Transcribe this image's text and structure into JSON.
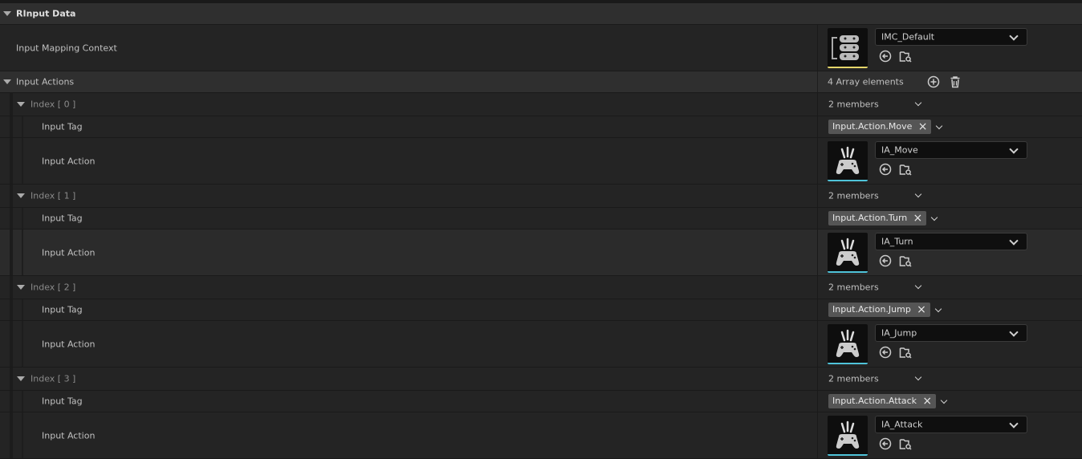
{
  "category": {
    "title": "RInput Data"
  },
  "mapping": {
    "label": "Input Mapping Context",
    "value": "IMC_Default",
    "thumb_color": "#e5d66a"
  },
  "actions": {
    "label": "Input Actions",
    "count_text": "4 Array elements"
  },
  "entries": [
    {
      "index_label": "Index [ 0 ]",
      "members": "2 members",
      "tag_label": "Input Tag",
      "tag": "Input.Action.Move",
      "action_label": "Input Action",
      "action": "IA_Move"
    },
    {
      "index_label": "Index [ 1 ]",
      "members": "2 members",
      "tag_label": "Input Tag",
      "tag": "Input.Action.Turn",
      "action_label": "Input Action",
      "action": "IA_Turn"
    },
    {
      "index_label": "Index [ 2 ]",
      "members": "2 members",
      "tag_label": "Input Tag",
      "tag": "Input.Action.Jump",
      "action_label": "Input Action",
      "action": "IA_Jump"
    },
    {
      "index_label": "Index [ 3 ]",
      "members": "2 members",
      "tag_label": "Input Tag",
      "tag": "Input.Action.Attack",
      "action_label": "Input Action",
      "action": "IA_Attack"
    }
  ],
  "icons": {
    "collapse": "triangle-down-icon",
    "combo": "chevron-down-icon",
    "use": "use-selected-arrow-icon",
    "browse": "browse-folder-search-icon",
    "add": "add-circle-icon",
    "delete": "trash-icon",
    "tag_remove": "x-icon",
    "thumb_mapping": "input-mapping-context-icon",
    "thumb_action": "gamepad-icon"
  },
  "colors": {
    "action_thumb_bar": "#4fc3d9",
    "mapping_thumb_bar": "#e5d66a"
  }
}
